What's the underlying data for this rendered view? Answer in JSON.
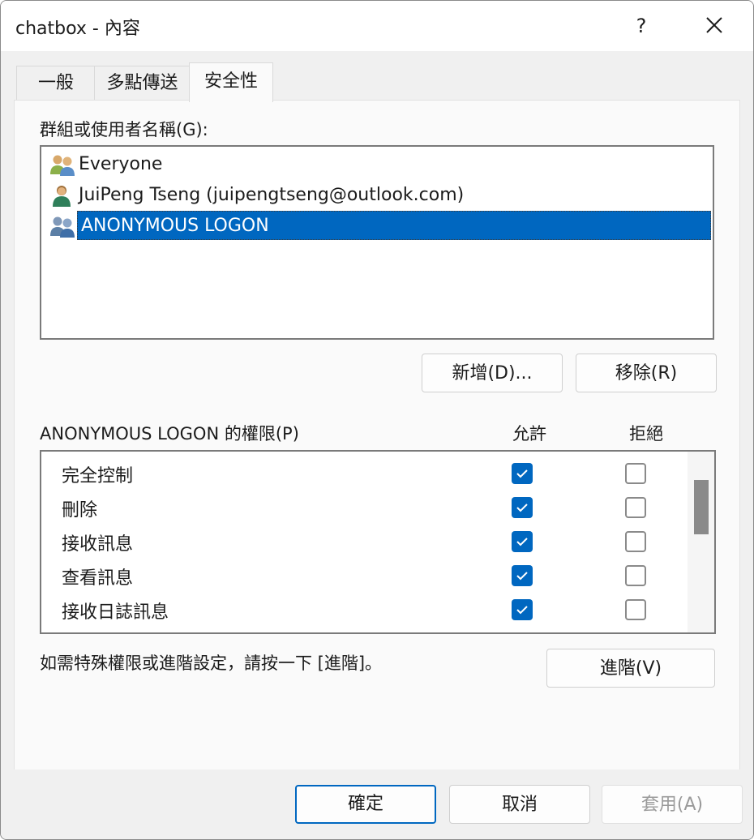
{
  "window": {
    "title": "chatbox - 內容",
    "help_label": "?"
  },
  "tabs": [
    {
      "label": "一般",
      "active": false
    },
    {
      "label": "多點傳送",
      "active": false
    },
    {
      "label": "安全性",
      "active": true
    }
  ],
  "security": {
    "groups_label": "群組或使用者名稱(G):",
    "users": [
      {
        "name": "Everyone",
        "icon": "group-icon",
        "selected": false
      },
      {
        "name": "JuiPeng Tseng (juipengtseng@outlook.com)",
        "icon": "user-icon",
        "selected": false
      },
      {
        "name": "ANONYMOUS LOGON",
        "icon": "group-icon",
        "selected": true
      }
    ],
    "add_button": "新增(D)...",
    "remove_button": "移除(R)",
    "permissions_label": "ANONYMOUS LOGON 的權限(P)",
    "allow_header": "允許",
    "deny_header": "拒絕",
    "permissions": [
      {
        "name": "完全控制",
        "allow": true,
        "deny": false
      },
      {
        "name": "刪除",
        "allow": true,
        "deny": false
      },
      {
        "name": "接收訊息",
        "allow": true,
        "deny": false
      },
      {
        "name": "查看訊息",
        "allow": true,
        "deny": false
      },
      {
        "name": "接收日誌訊息",
        "allow": true,
        "deny": false
      }
    ],
    "advanced_hint": "如需特殊權限或進階設定，請按一下 [進階]。",
    "advanced_button": "進階(V)"
  },
  "footer": {
    "ok_button": "確定",
    "cancel_button": "取消",
    "apply_button": "套用(A)"
  },
  "colors": {
    "accent": "#0067c0",
    "selection": "#0067c0"
  }
}
